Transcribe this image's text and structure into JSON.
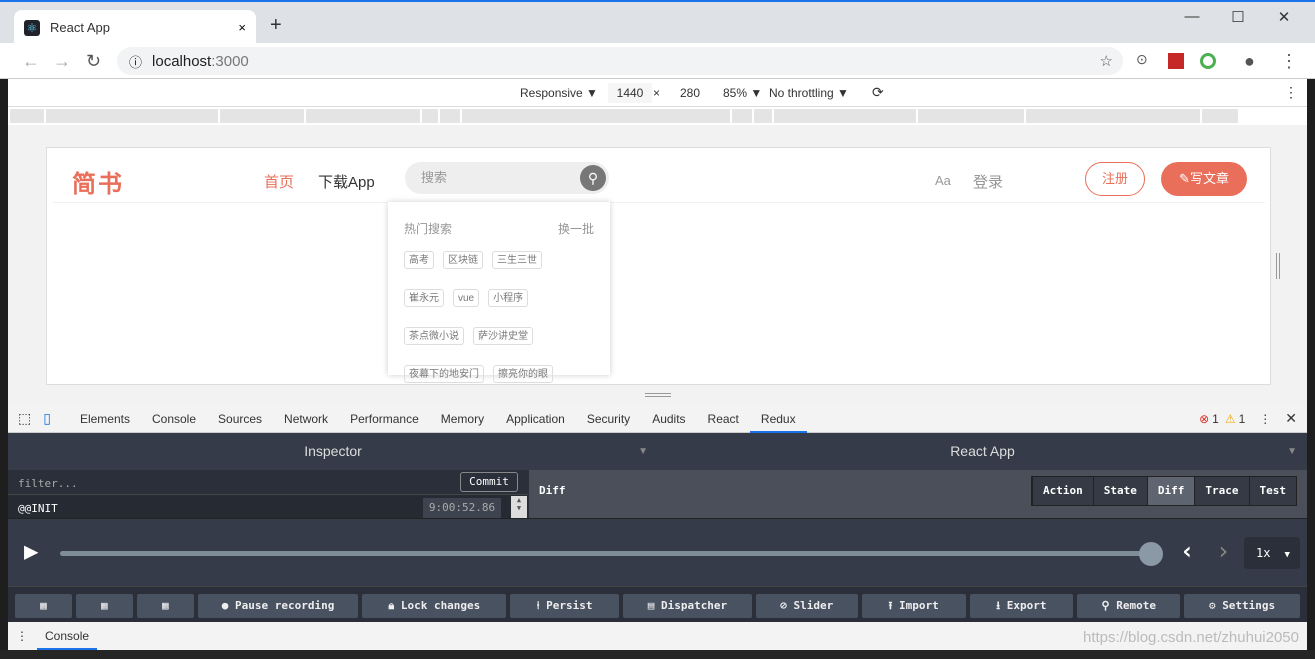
{
  "browser": {
    "tab_title": "React App",
    "url_host": "localhost",
    "url_port": ":3000",
    "new_tab": "+",
    "close": "×",
    "win": [
      "—",
      "☐",
      "✕"
    ]
  },
  "device_toolbar": {
    "mode": "Responsive ▼",
    "width": "1440",
    "x": "×",
    "height": "280",
    "zoom": "85% ▼",
    "throttle": "No throttling ▼"
  },
  "site": {
    "logo": "简书",
    "nav": [
      "首页",
      "下载App"
    ],
    "search_placeholder": "搜索",
    "aa": "Aa",
    "login": "登录",
    "register": "注册",
    "write": "写文章",
    "hot": {
      "title": "热门搜索",
      "switch": "换一批",
      "tags": [
        "高考",
        "区块链",
        "三生三世",
        "崔永元",
        "vue",
        "小程序",
        "茶点微小说",
        "萨沙讲史堂",
        "夜幕下的地安门",
        "擦亮你的眼"
      ]
    },
    "accent": "#ea6f5a"
  },
  "devtools": {
    "tabs": [
      "Elements",
      "Console",
      "Sources",
      "Network",
      "Performance",
      "Memory",
      "Application",
      "Security",
      "Audits",
      "React",
      "Redux"
    ],
    "active": "Redux",
    "errors": "1",
    "warnings": "1"
  },
  "redux": {
    "left_title": "Inspector",
    "right_title": "React App",
    "filter_placeholder": "filter...",
    "commit": "Commit",
    "action": "@@INIT",
    "time": "9:00:52.86",
    "diff": "Diff",
    "tabs": [
      "Action",
      "State",
      "Diff",
      "Trace",
      "Test"
    ],
    "active_tab": "Diff",
    "speed": "1x",
    "buttons": [
      "",
      "",
      "",
      "Pause recording",
      "Lock changes",
      "Persist",
      "Dispatcher",
      "Slider",
      "Import",
      "Export",
      "Remote",
      "Settings"
    ],
    "slider_position": 1.0
  },
  "drawer": {
    "tab": "Console"
  },
  "watermark": "https://blog.csdn.net/zhuhui2050"
}
